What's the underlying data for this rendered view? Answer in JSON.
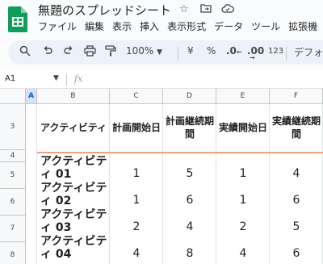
{
  "title": {
    "doc_name": "無題のスプレッドシート",
    "star_icon": "star-icon",
    "move_icon": "folder-move-icon",
    "cloud_icon": "cloud-status-icon"
  },
  "menu": [
    "ファイル",
    "編集",
    "表示",
    "挿入",
    "表示形式",
    "データ",
    "ツール",
    "拡張機"
  ],
  "toolbar": {
    "zoom": "100%",
    "currency": "¥",
    "percent": "%",
    "decimal_decrease": ".0",
    "decimal_increase": ".00",
    "number_format": "123",
    "font": "デフォ"
  },
  "formula_bar": {
    "cell_ref": "A1",
    "fx": "fx",
    "value": ""
  },
  "grid": {
    "columns": [
      "A",
      "B",
      "C",
      "D",
      "E",
      "F"
    ],
    "active_column": "A",
    "row_numbers": [
      "3",
      "4",
      "5",
      "6",
      "7",
      "8"
    ],
    "headers": [
      "アクティビティ",
      "計画開始日",
      "計画継続期間",
      "実績開始日",
      "実績継続期間"
    ],
    "rows": [
      {
        "name": "アクティビティ 01",
        "values": [
          "1",
          "5",
          "1",
          "4"
        ]
      },
      {
        "name": "アクティビティ 02",
        "values": [
          "1",
          "6",
          "1",
          "6"
        ]
      },
      {
        "name": "アクティビティ 03",
        "values": [
          "2",
          "4",
          "2",
          "5"
        ]
      },
      {
        "name": "アクティビティ 04",
        "values": [
          "4",
          "8",
          "4",
          "6"
        ]
      }
    ]
  }
}
